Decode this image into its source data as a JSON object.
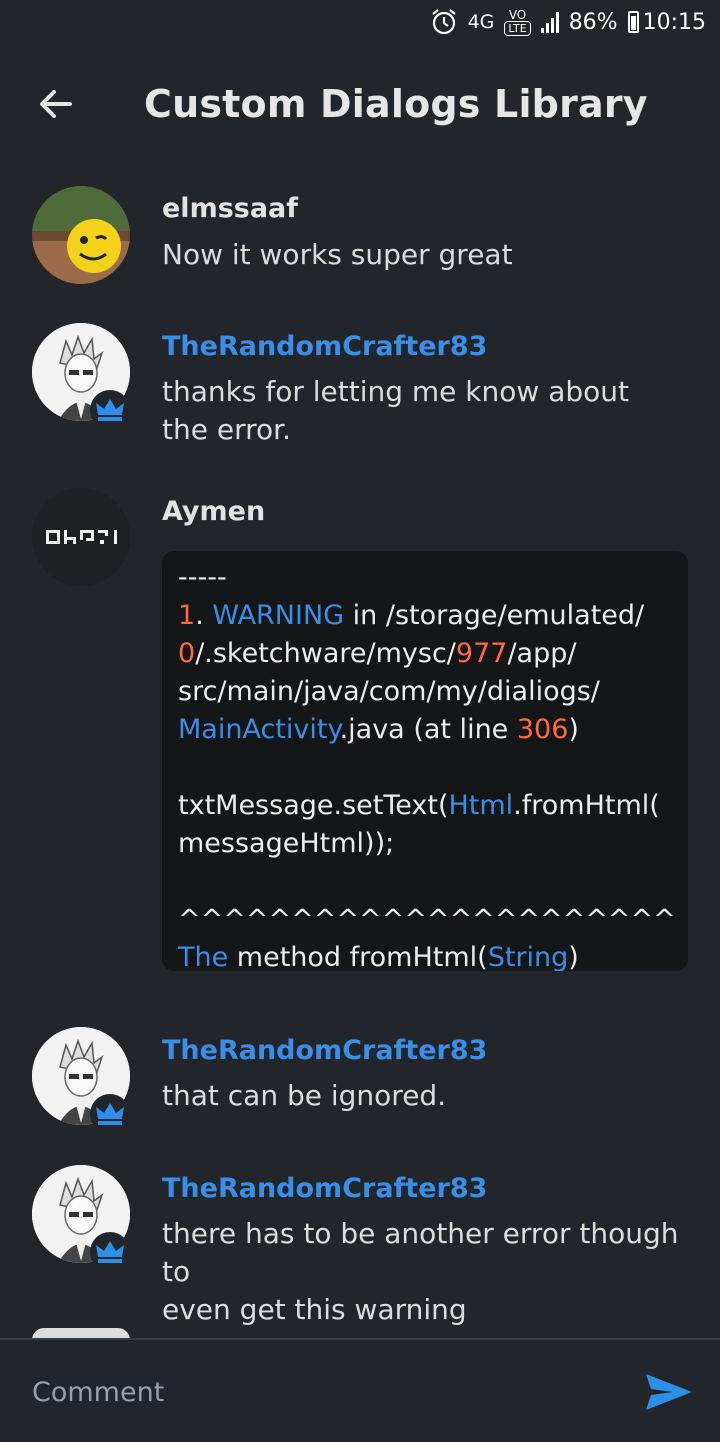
{
  "status_bar": {
    "network": "4G",
    "volte": "VO",
    "lte": "LTE",
    "battery": "86%",
    "time": "10:15"
  },
  "header": {
    "title": "Custom Dialogs Library"
  },
  "comments": [
    {
      "user": "elmssaaf",
      "message": "Now it works super great"
    },
    {
      "user": "TheRandomCrafter83",
      "message_lines": [
        "thanks for letting me know about",
        "the error."
      ]
    },
    {
      "user": "Aymen"
    },
    {
      "user": "TheRandomCrafter83",
      "message": "that can be ignored."
    },
    {
      "user": "TheRandomCrafter83",
      "message_lines": [
        "there has to be another error though to",
        "even get this warning"
      ]
    }
  ],
  "code_block": {
    "sep": "-----",
    "l1_num": "1",
    "l1_dot": ". ",
    "l1_warn": "WARNING",
    "l1_rest": " in /storage/emulated/",
    "l2_zero": "0",
    "l2_mid": "/.sketchware/mysc/",
    "l2_num": "977",
    "l2_end": "/app/",
    "l3": "src/main/java/com/my/dialiogs/",
    "l4_cls": "MainActivity",
    "l4_mid": ".java (at line ",
    "l4_num": "306",
    "l4_end": ")",
    "l6_a": "txtMessage.setText(",
    "l6_b": "Html",
    "l6_c": ".fromHtml(",
    "l7": "messageHtml));",
    "l9": "^^^^^^^^^^^^^^^^^^^^^^",
    "l10_a": "The",
    "l10_b": " method fromHtml(",
    "l10_c": "String",
    "l10_d": ")"
  },
  "composer": {
    "placeholder": "Comment"
  },
  "colors": {
    "background": "#22252a",
    "accent_blue": "#3a8ee6",
    "code_number": "#ff6a3d"
  }
}
